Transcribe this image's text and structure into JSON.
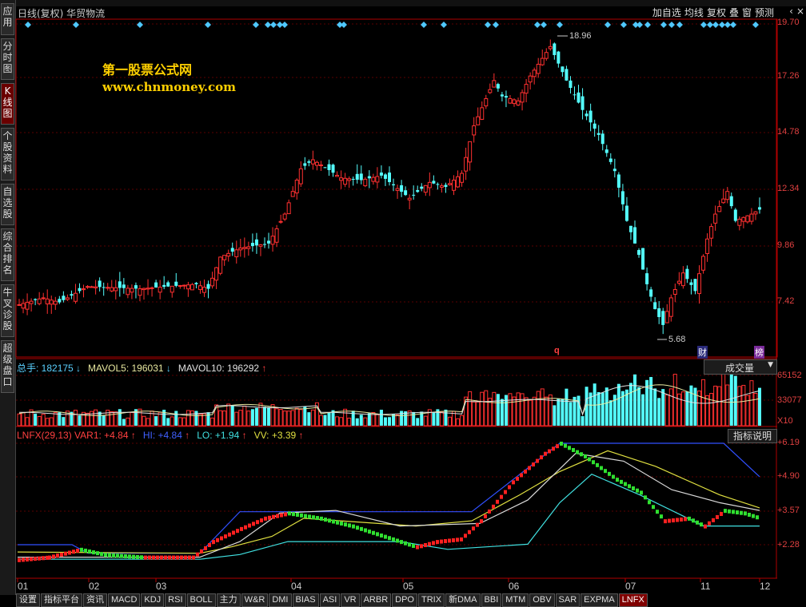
{
  "sidebar": {
    "tabs": [
      {
        "label": "应用",
        "active": false
      },
      {
        "label": "分时图",
        "active": false
      },
      {
        "label": "K线图",
        "active": true
      },
      {
        "label": "个股资料",
        "active": false
      },
      {
        "label": "自选股",
        "active": false
      },
      {
        "label": "综合排名",
        "active": false
      },
      {
        "label": "牛叉诊股",
        "active": false
      },
      {
        "label": "超级盘口",
        "active": false
      }
    ]
  },
  "header": {
    "title": "日线(复权) 华贸物流",
    "toolbar": [
      "加自选",
      "均线",
      "复权",
      "叠",
      "窗",
      "预测"
    ],
    "window_buttons": [
      "‹",
      "×"
    ]
  },
  "watermark": {
    "line1": "第一股票公式网",
    "line2": "www.chnmoney.com"
  },
  "price_axis": [
    "19.70",
    "17.26",
    "14.78",
    "12.34",
    "9.86",
    "7.42"
  ],
  "annotations": {
    "high": "18.96",
    "low": "5.68",
    "marker_q": "q",
    "marker_cai": "财",
    "marker_bang": "榜"
  },
  "volume_panel": {
    "legend": [
      {
        "label": "总手: 182175",
        "arrow": "↓",
        "color": "#5ad0ff"
      },
      {
        "label": "MAVOL5: 196031",
        "arrow": "↓",
        "color": "#e8e8a0"
      },
      {
        "label": "MAVOL10: 196292",
        "arrow": "↑",
        "color": "#e0e0e0"
      }
    ],
    "dropdown": "成交量",
    "axis": [
      "65152",
      "33077",
      "X10"
    ]
  },
  "indicator_panel": {
    "legend": [
      {
        "label": "LNFX(29,13) VAR1: +4.84",
        "arrow": "↑",
        "color": "#ff4040"
      },
      {
        "label": "HI: +4.84",
        "arrow": "↑",
        "color": "#4060ff"
      },
      {
        "label": "LO: +1.94",
        "arrow": "↑",
        "color": "#40e0e0"
      },
      {
        "label": "VV: +3.39",
        "arrow": "↑",
        "color": "#e0e040"
      }
    ],
    "help_button": "指标说明",
    "axis": [
      "+6.19",
      "+4.90",
      "+3.57",
      "+2.28"
    ]
  },
  "x_axis": [
    "01",
    "02",
    "03",
    "04",
    "05",
    "06",
    "07",
    "11",
    "12"
  ],
  "bottom_tabs": [
    "设置",
    "指标平台",
    "资讯",
    "MACD",
    "KDJ",
    "RSI",
    "BOLL",
    "主力",
    "W&R",
    "DMI",
    "BIAS",
    "ASI",
    "VR",
    "ARBR",
    "DPO",
    "TRIX",
    "新DMA",
    "BBI",
    "MTM",
    "OBV",
    "SAR",
    "EXPMA",
    "LNFX"
  ],
  "active_tab": "LNFX",
  "colors": {
    "up": "#ff3030",
    "down": "#54ffff",
    "axis": "#b00000",
    "background": "#000000"
  }
}
